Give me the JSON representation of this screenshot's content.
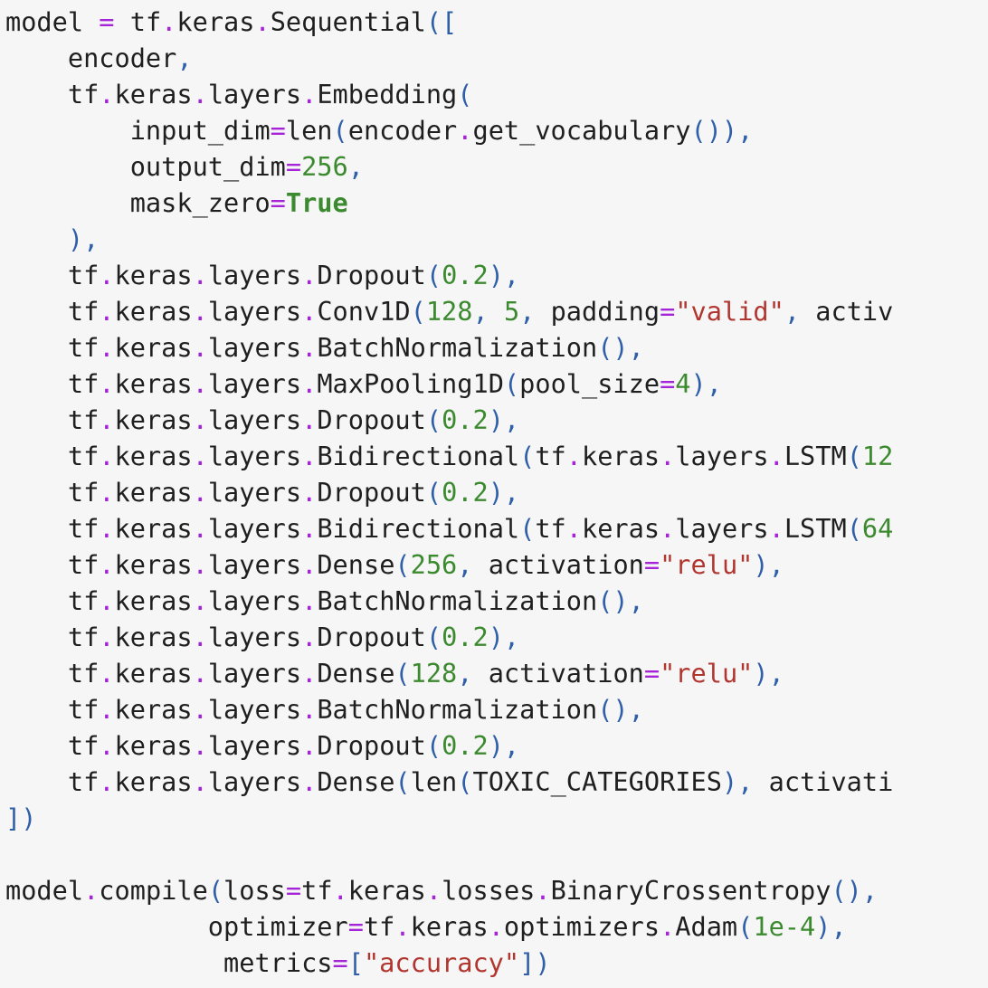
{
  "palette": {
    "background": "#f6f6f6",
    "text": "#1f1f1f",
    "operator": "#a524d8",
    "punctuation": "#2f5fa8",
    "number": "#3c8a2f",
    "string": "#b1362f",
    "keyword": "#3c8a2f"
  },
  "code": {
    "language": "python",
    "lines": [
      [
        [
          "t",
          "model "
        ],
        [
          "o",
          "="
        ],
        [
          "t",
          " tf"
        ],
        [
          "o",
          "."
        ],
        [
          "t",
          "keras"
        ],
        [
          "o",
          "."
        ],
        [
          "t",
          "Sequential"
        ],
        [
          "p",
          "(["
        ]
      ],
      [
        [
          "t",
          "    encoder"
        ],
        [
          "p",
          ","
        ]
      ],
      [
        [
          "t",
          "    tf"
        ],
        [
          "o",
          "."
        ],
        [
          "t",
          "keras"
        ],
        [
          "o",
          "."
        ],
        [
          "t",
          "layers"
        ],
        [
          "o",
          "."
        ],
        [
          "t",
          "Embedding"
        ],
        [
          "p",
          "("
        ]
      ],
      [
        [
          "t",
          "        input_dim"
        ],
        [
          "o",
          "="
        ],
        [
          "t",
          "len"
        ],
        [
          "p",
          "("
        ],
        [
          "t",
          "encoder"
        ],
        [
          "o",
          "."
        ],
        [
          "t",
          "get_vocabulary"
        ],
        [
          "p",
          "()),"
        ]
      ],
      [
        [
          "t",
          "        output_dim"
        ],
        [
          "o",
          "="
        ],
        [
          "n",
          "256"
        ],
        [
          "p",
          ","
        ]
      ],
      [
        [
          "t",
          "        mask_zero"
        ],
        [
          "o",
          "="
        ],
        [
          "k",
          "True"
        ]
      ],
      [
        [
          "p",
          "    ),"
        ]
      ],
      [
        [
          "t",
          "    tf"
        ],
        [
          "o",
          "."
        ],
        [
          "t",
          "keras"
        ],
        [
          "o",
          "."
        ],
        [
          "t",
          "layers"
        ],
        [
          "o",
          "."
        ],
        [
          "t",
          "Dropout"
        ],
        [
          "p",
          "("
        ],
        [
          "n",
          "0.2"
        ],
        [
          "p",
          "),"
        ]
      ],
      [
        [
          "t",
          "    tf"
        ],
        [
          "o",
          "."
        ],
        [
          "t",
          "keras"
        ],
        [
          "o",
          "."
        ],
        [
          "t",
          "layers"
        ],
        [
          "o",
          "."
        ],
        [
          "t",
          "Conv1D"
        ],
        [
          "p",
          "("
        ],
        [
          "n",
          "128"
        ],
        [
          "p",
          ", "
        ],
        [
          "n",
          "5"
        ],
        [
          "p",
          ", "
        ],
        [
          "t",
          "padding"
        ],
        [
          "o",
          "="
        ],
        [
          "s",
          "\"valid\""
        ],
        [
          "p",
          ", "
        ],
        [
          "t",
          "activ"
        ]
      ],
      [
        [
          "t",
          "    tf"
        ],
        [
          "o",
          "."
        ],
        [
          "t",
          "keras"
        ],
        [
          "o",
          "."
        ],
        [
          "t",
          "layers"
        ],
        [
          "o",
          "."
        ],
        [
          "t",
          "BatchNormalization"
        ],
        [
          "p",
          "(),"
        ]
      ],
      [
        [
          "t",
          "    tf"
        ],
        [
          "o",
          "."
        ],
        [
          "t",
          "keras"
        ],
        [
          "o",
          "."
        ],
        [
          "t",
          "layers"
        ],
        [
          "o",
          "."
        ],
        [
          "t",
          "MaxPooling1D"
        ],
        [
          "p",
          "("
        ],
        [
          "t",
          "pool_size"
        ],
        [
          "o",
          "="
        ],
        [
          "n",
          "4"
        ],
        [
          "p",
          "),"
        ]
      ],
      [
        [
          "t",
          "    tf"
        ],
        [
          "o",
          "."
        ],
        [
          "t",
          "keras"
        ],
        [
          "o",
          "."
        ],
        [
          "t",
          "layers"
        ],
        [
          "o",
          "."
        ],
        [
          "t",
          "Dropout"
        ],
        [
          "p",
          "("
        ],
        [
          "n",
          "0.2"
        ],
        [
          "p",
          "),"
        ]
      ],
      [
        [
          "t",
          "    tf"
        ],
        [
          "o",
          "."
        ],
        [
          "t",
          "keras"
        ],
        [
          "o",
          "."
        ],
        [
          "t",
          "layers"
        ],
        [
          "o",
          "."
        ],
        [
          "t",
          "Bidirectional"
        ],
        [
          "p",
          "("
        ],
        [
          "t",
          "tf"
        ],
        [
          "o",
          "."
        ],
        [
          "t",
          "keras"
        ],
        [
          "o",
          "."
        ],
        [
          "t",
          "layers"
        ],
        [
          "o",
          "."
        ],
        [
          "t",
          "LSTM"
        ],
        [
          "p",
          "("
        ],
        [
          "n",
          "12"
        ]
      ],
      [
        [
          "t",
          "    tf"
        ],
        [
          "o",
          "."
        ],
        [
          "t",
          "keras"
        ],
        [
          "o",
          "."
        ],
        [
          "t",
          "layers"
        ],
        [
          "o",
          "."
        ],
        [
          "t",
          "Dropout"
        ],
        [
          "p",
          "("
        ],
        [
          "n",
          "0.2"
        ],
        [
          "p",
          "),"
        ]
      ],
      [
        [
          "t",
          "    tf"
        ],
        [
          "o",
          "."
        ],
        [
          "t",
          "keras"
        ],
        [
          "o",
          "."
        ],
        [
          "t",
          "layers"
        ],
        [
          "o",
          "."
        ],
        [
          "t",
          "Bidirectional"
        ],
        [
          "p",
          "("
        ],
        [
          "t",
          "tf"
        ],
        [
          "o",
          "."
        ],
        [
          "t",
          "keras"
        ],
        [
          "o",
          "."
        ],
        [
          "t",
          "layers"
        ],
        [
          "o",
          "."
        ],
        [
          "t",
          "LSTM"
        ],
        [
          "p",
          "("
        ],
        [
          "n",
          "64"
        ]
      ],
      [
        [
          "t",
          "    tf"
        ],
        [
          "o",
          "."
        ],
        [
          "t",
          "keras"
        ],
        [
          "o",
          "."
        ],
        [
          "t",
          "layers"
        ],
        [
          "o",
          "."
        ],
        [
          "t",
          "Dense"
        ],
        [
          "p",
          "("
        ],
        [
          "n",
          "256"
        ],
        [
          "p",
          ", "
        ],
        [
          "t",
          "activation"
        ],
        [
          "o",
          "="
        ],
        [
          "s",
          "\"relu\""
        ],
        [
          "p",
          "),"
        ]
      ],
      [
        [
          "t",
          "    tf"
        ],
        [
          "o",
          "."
        ],
        [
          "t",
          "keras"
        ],
        [
          "o",
          "."
        ],
        [
          "t",
          "layers"
        ],
        [
          "o",
          "."
        ],
        [
          "t",
          "BatchNormalization"
        ],
        [
          "p",
          "(),"
        ]
      ],
      [
        [
          "t",
          "    tf"
        ],
        [
          "o",
          "."
        ],
        [
          "t",
          "keras"
        ],
        [
          "o",
          "."
        ],
        [
          "t",
          "layers"
        ],
        [
          "o",
          "."
        ],
        [
          "t",
          "Dropout"
        ],
        [
          "p",
          "("
        ],
        [
          "n",
          "0.2"
        ],
        [
          "p",
          "),"
        ]
      ],
      [
        [
          "t",
          "    tf"
        ],
        [
          "o",
          "."
        ],
        [
          "t",
          "keras"
        ],
        [
          "o",
          "."
        ],
        [
          "t",
          "layers"
        ],
        [
          "o",
          "."
        ],
        [
          "t",
          "Dense"
        ],
        [
          "p",
          "("
        ],
        [
          "n",
          "128"
        ],
        [
          "p",
          ", "
        ],
        [
          "t",
          "activation"
        ],
        [
          "o",
          "="
        ],
        [
          "s",
          "\"relu\""
        ],
        [
          "p",
          "),"
        ]
      ],
      [
        [
          "t",
          "    tf"
        ],
        [
          "o",
          "."
        ],
        [
          "t",
          "keras"
        ],
        [
          "o",
          "."
        ],
        [
          "t",
          "layers"
        ],
        [
          "o",
          "."
        ],
        [
          "t",
          "BatchNormalization"
        ],
        [
          "p",
          "(),"
        ]
      ],
      [
        [
          "t",
          "    tf"
        ],
        [
          "o",
          "."
        ],
        [
          "t",
          "keras"
        ],
        [
          "o",
          "."
        ],
        [
          "t",
          "layers"
        ],
        [
          "o",
          "."
        ],
        [
          "t",
          "Dropout"
        ],
        [
          "p",
          "("
        ],
        [
          "n",
          "0.2"
        ],
        [
          "p",
          "),"
        ]
      ],
      [
        [
          "t",
          "    tf"
        ],
        [
          "o",
          "."
        ],
        [
          "t",
          "keras"
        ],
        [
          "o",
          "."
        ],
        [
          "t",
          "layers"
        ],
        [
          "o",
          "."
        ],
        [
          "t",
          "Dense"
        ],
        [
          "p",
          "("
        ],
        [
          "t",
          "len"
        ],
        [
          "p",
          "("
        ],
        [
          "t",
          "TOXIC_CATEGORIES"
        ],
        [
          "p",
          "), "
        ],
        [
          "t",
          "activati"
        ]
      ],
      [
        [
          "p",
          "])"
        ]
      ],
      [],
      [
        [
          "t",
          "model"
        ],
        [
          "o",
          "."
        ],
        [
          "t",
          "compile"
        ],
        [
          "p",
          "("
        ],
        [
          "t",
          "loss"
        ],
        [
          "o",
          "="
        ],
        [
          "t",
          "tf"
        ],
        [
          "o",
          "."
        ],
        [
          "t",
          "keras"
        ],
        [
          "o",
          "."
        ],
        [
          "t",
          "losses"
        ],
        [
          "o",
          "."
        ],
        [
          "t",
          "BinaryCrossentropy"
        ],
        [
          "p",
          "(), "
        ]
      ],
      [
        [
          "t",
          "             optimizer"
        ],
        [
          "o",
          "="
        ],
        [
          "t",
          "tf"
        ],
        [
          "o",
          "."
        ],
        [
          "t",
          "keras"
        ],
        [
          "o",
          "."
        ],
        [
          "t",
          "optimizers"
        ],
        [
          "o",
          "."
        ],
        [
          "t",
          "Adam"
        ],
        [
          "p",
          "("
        ],
        [
          "n",
          "1e-4"
        ],
        [
          "p",
          "),"
        ]
      ],
      [
        [
          "t",
          "              metrics"
        ],
        [
          "o",
          "="
        ],
        [
          "p",
          "["
        ],
        [
          "s",
          "\"accuracy\""
        ],
        [
          "p",
          "])"
        ]
      ]
    ]
  }
}
